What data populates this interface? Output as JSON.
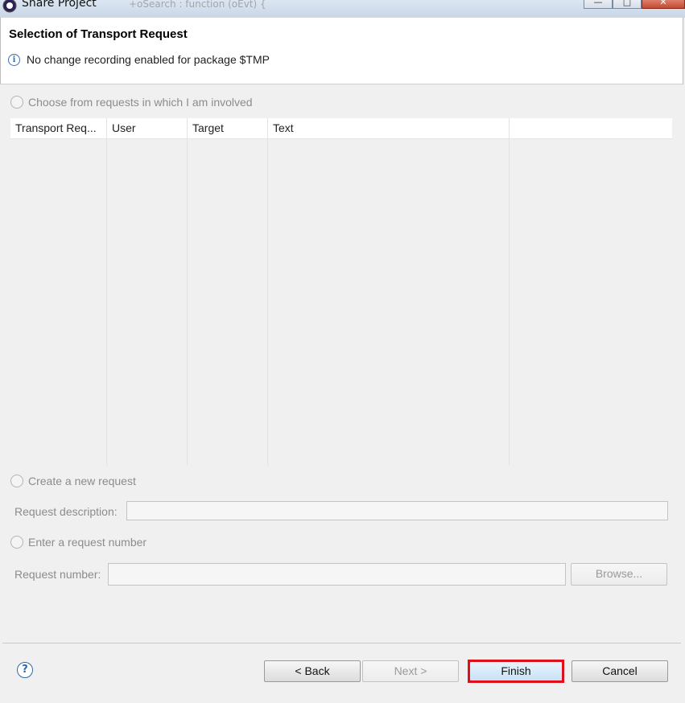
{
  "window": {
    "title": "Share Project",
    "background_snippet": "+oSearch : function (oEvt) {",
    "controls": [
      "minimize-icon",
      "maximize-icon",
      "close-icon"
    ]
  },
  "header": {
    "title": "Selection of Transport Request",
    "info_icon": "info-icon",
    "message": "No change recording enabled for package $TMP"
  },
  "options": {
    "choose_label": "Choose from requests in which I am involved",
    "create_label": "Create a new request",
    "enter_label": "Enter a request number"
  },
  "table": {
    "columns": [
      "Transport Req...",
      "User",
      "Target",
      "Text",
      ""
    ],
    "rows": []
  },
  "fields": {
    "request_description_label": "Request description:",
    "request_description_value": "",
    "request_number_label": "Request number:",
    "request_number_value": "",
    "browse_label": "Browse..."
  },
  "footer": {
    "help_icon": "help-icon",
    "back_label": "< Back",
    "next_label": "Next >",
    "finish_label": "Finish",
    "cancel_label": "Cancel"
  },
  "colors": {
    "highlight": "#e0101a",
    "accent": "#3a6fb0"
  }
}
